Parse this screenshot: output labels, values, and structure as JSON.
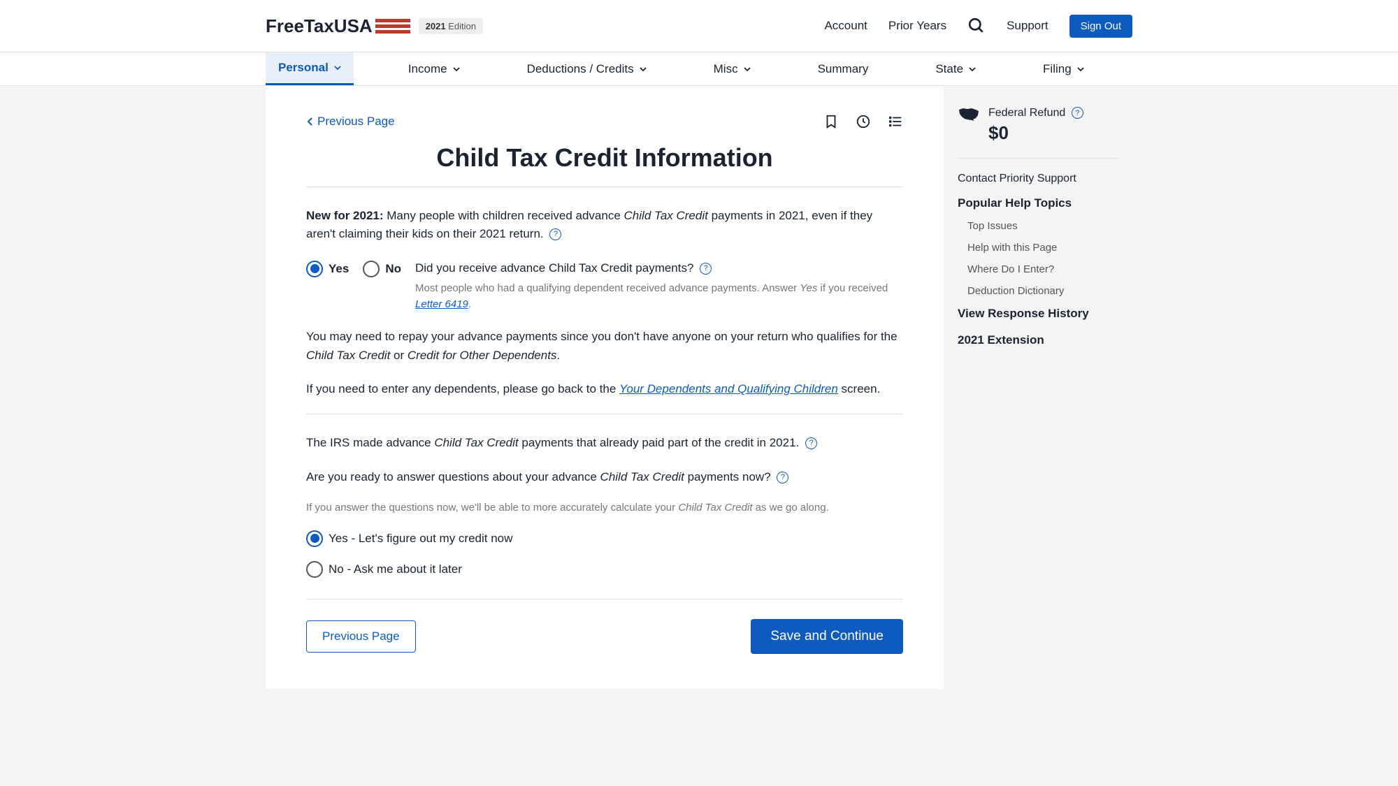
{
  "header": {
    "logo_text": "FreeTaxUSA",
    "edition_year": "2021",
    "edition_label": "Edition",
    "nav": {
      "account": "Account",
      "prior_years": "Prior Years",
      "support": "Support",
      "sign_out": "Sign Out"
    }
  },
  "menu": {
    "items": [
      {
        "label": "Personal",
        "active": true,
        "hasDropdown": true
      },
      {
        "label": "Income",
        "active": false,
        "hasDropdown": true
      },
      {
        "label": "Deductions / Credits",
        "active": false,
        "hasDropdown": true
      },
      {
        "label": "Misc",
        "active": false,
        "hasDropdown": true
      },
      {
        "label": "Summary",
        "active": false,
        "hasDropdown": false
      },
      {
        "label": "State",
        "active": false,
        "hasDropdown": true
      },
      {
        "label": "Filing",
        "active": false,
        "hasDropdown": true
      }
    ]
  },
  "page": {
    "previous_link": "Previous Page",
    "title": "Child Tax Credit Information",
    "intro_bold": "New for 2021:",
    "intro_p1a": " Many people with children received advance ",
    "intro_italic1": "Child Tax Credit",
    "intro_p1b": " payments in 2021, even if they aren't claiming their kids on their 2021 return.",
    "q1": {
      "yes": "Yes",
      "no": "No",
      "text_a": "Did you receive advance ",
      "text_italic": "Child Tax Credit",
      "text_b": " payments?",
      "hint_a": "Most people who had a qualifying dependent received advance payments. Answer ",
      "hint_italic": "Yes",
      "hint_b": " if you received ",
      "hint_link": "Letter 6419",
      "hint_c": "."
    },
    "repay_a": "You may need to repay your advance payments since you don't have anyone on your return who qualifies for the ",
    "repay_italic1": "Child Tax Credit",
    "repay_b": " or ",
    "repay_italic2": "Credit for Other Dependents",
    "repay_c": ".",
    "deps_a": "If you need to enter any dependents, please go back to the ",
    "deps_link": "Your Dependents and Qualifying Children",
    "deps_b": " screen.",
    "irs_a": "The IRS made advance ",
    "irs_italic": "Child Tax Credit",
    "irs_b": " payments that already paid part of the credit in 2021.",
    "ready_a": "Are you ready to answer questions about your advance ",
    "ready_italic": "Child Tax Credit",
    "ready_b": " payments now?",
    "ready_hint_a": "If you answer the questions now, we'll be able to more accurately calculate your ",
    "ready_hint_italic": "Child Tax Credit",
    "ready_hint_b": " as we go along.",
    "q2": {
      "opt_yes": "Yes - Let's figure out my credit now",
      "opt_no": "No - Ask me about it later"
    },
    "buttons": {
      "previous": "Previous Page",
      "continue": "Save and Continue"
    }
  },
  "sidebar": {
    "refund_label": "Federal Refund",
    "refund_amount": "$0",
    "contact": "Contact Priority Support",
    "popular_heading": "Popular Help Topics",
    "topics": [
      "Top Issues",
      "Help with this Page",
      "Where Do I Enter?",
      "Deduction Dictionary"
    ],
    "view_history": "View Response History",
    "extension": "2021 Extension"
  }
}
